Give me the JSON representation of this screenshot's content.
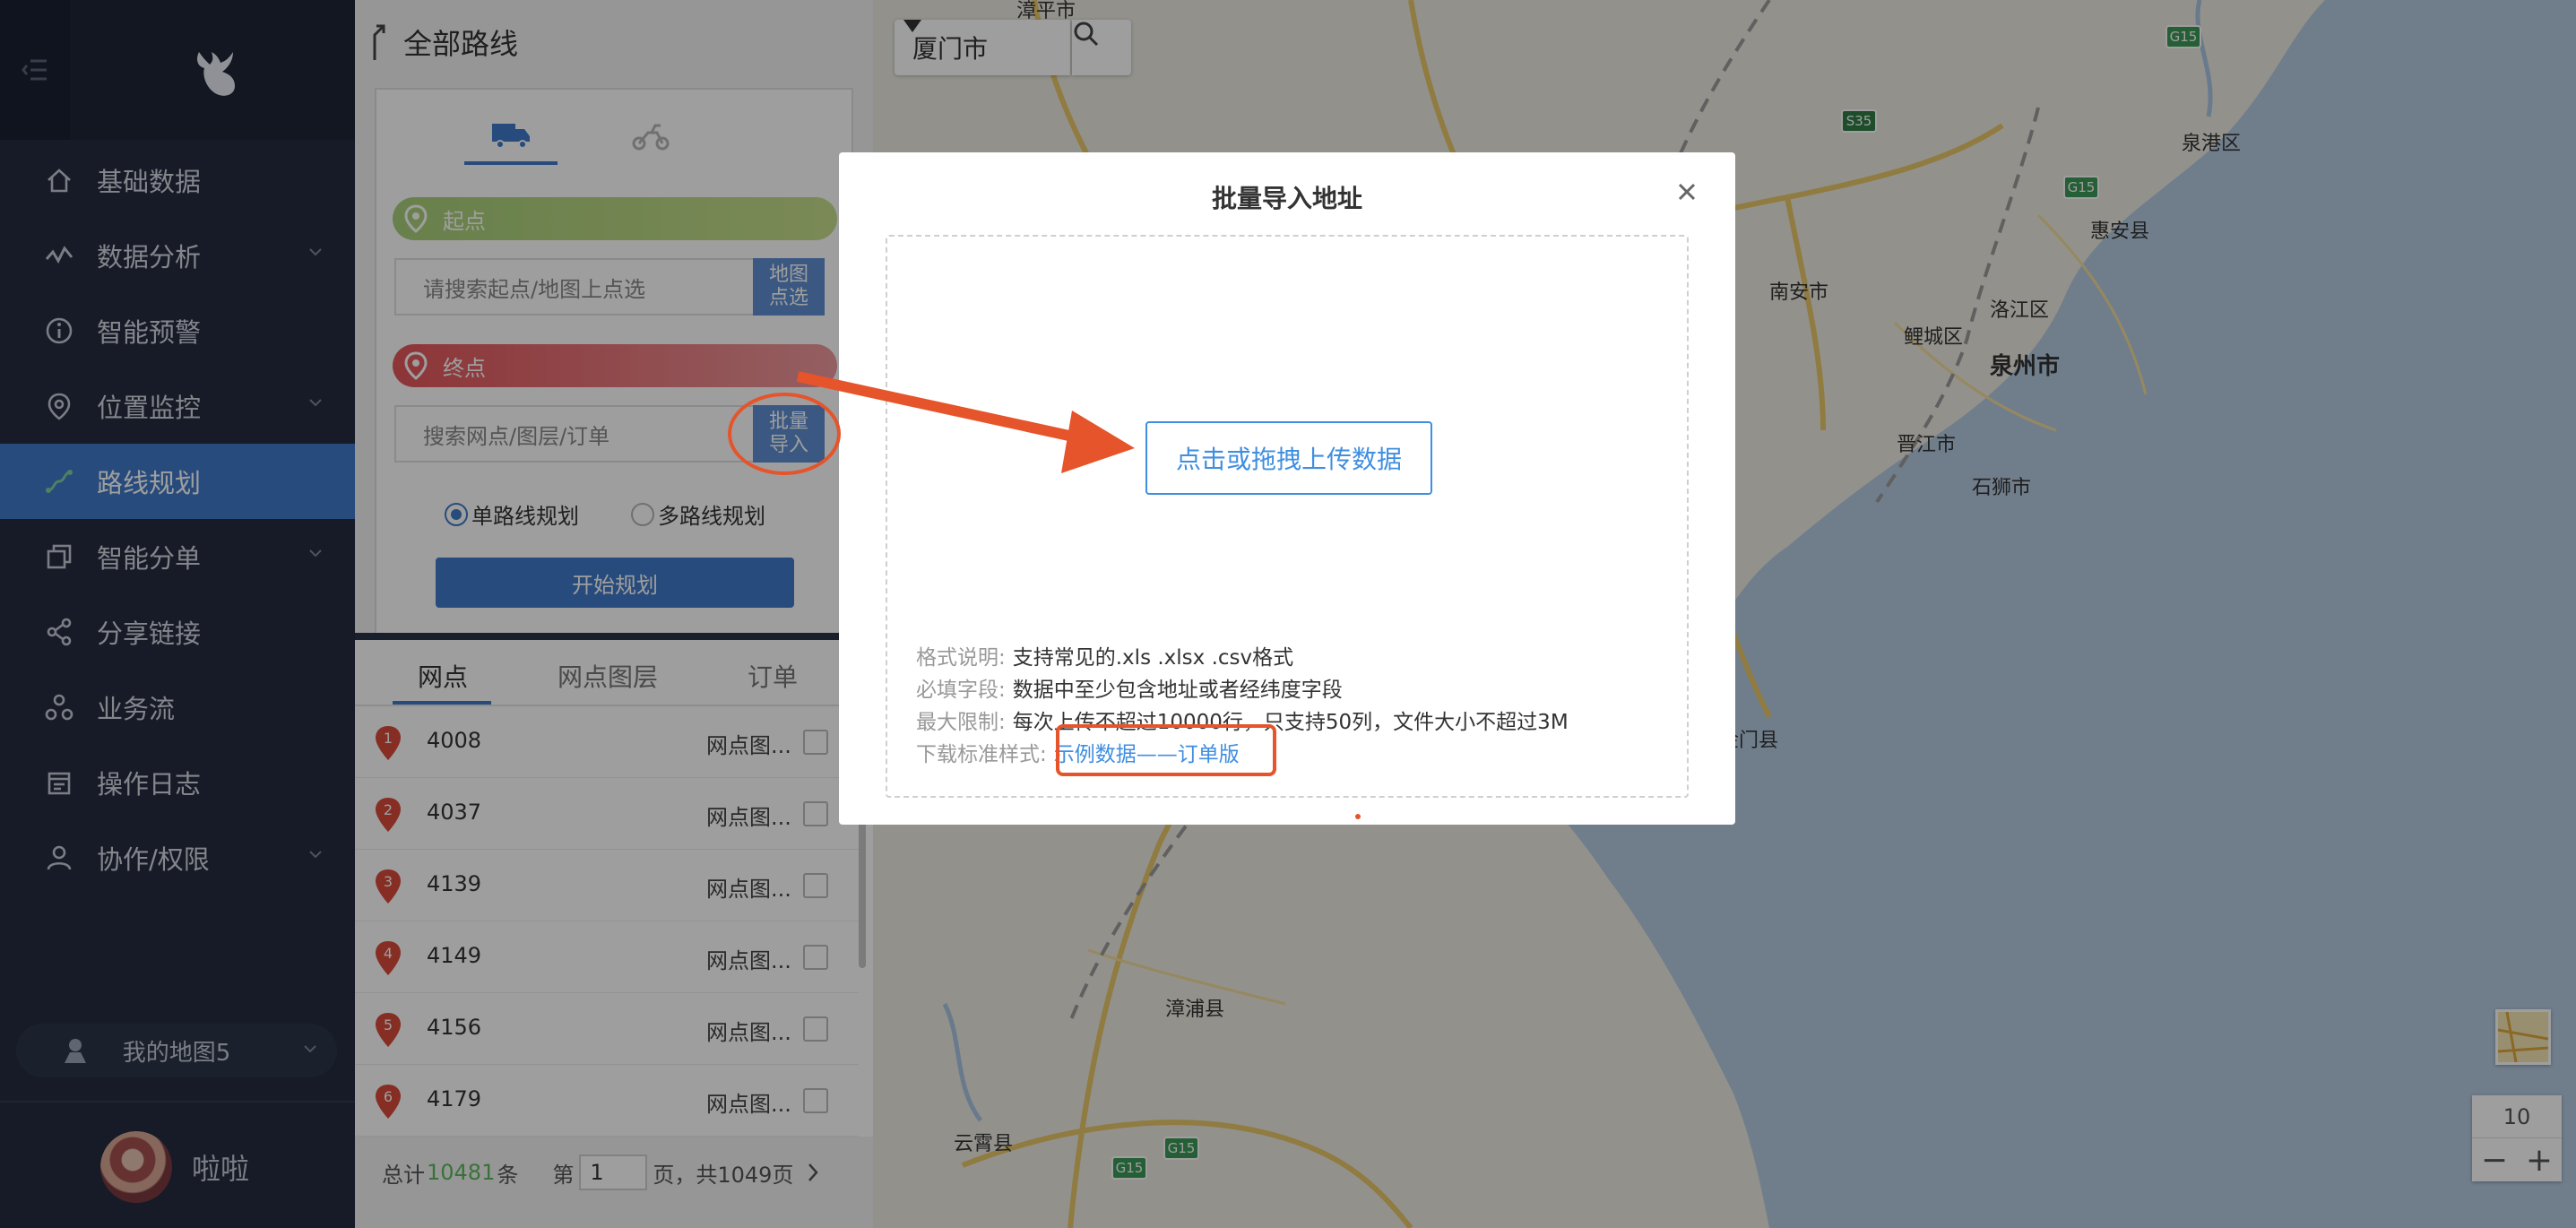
{
  "sidebar": {
    "menu": [
      {
        "label": "基础数据",
        "icon": "home-icon",
        "has_submenu": false,
        "active": false
      },
      {
        "label": "数据分析",
        "icon": "chart-line-icon",
        "has_submenu": true,
        "active": false
      },
      {
        "label": "智能预警",
        "icon": "info-icon",
        "has_submenu": false,
        "active": false
      },
      {
        "label": "位置监控",
        "icon": "location-pin-icon",
        "has_submenu": true,
        "active": false
      },
      {
        "label": "路线规划",
        "icon": "route-icon",
        "has_submenu": false,
        "active": true
      },
      {
        "label": "智能分单",
        "icon": "copy-icon",
        "has_submenu": true,
        "active": false
      },
      {
        "label": "分享链接",
        "icon": "share-icon",
        "has_submenu": false,
        "active": false
      },
      {
        "label": "业务流",
        "icon": "workflow-icon",
        "has_submenu": false,
        "active": false
      },
      {
        "label": "操作日志",
        "icon": "calendar-icon",
        "has_submenu": false,
        "active": false
      },
      {
        "label": "协作/权限",
        "icon": "user-icon",
        "has_submenu": true,
        "active": false
      }
    ],
    "my_map": "我的地图5",
    "user_name": "啦啦"
  },
  "panel": {
    "title": "全部路线",
    "start_label": "起点",
    "start_placeholder": "请搜索起点/地图上点选",
    "start_btn": "地图点选",
    "end_label": "终点",
    "end_placeholder": "搜索网点/图层/订单",
    "end_btn": "批量导入",
    "mode_single": "单路线规划",
    "mode_multi": "多路线规划",
    "plan_btn": "开始规划",
    "list_tabs": [
      "网点",
      "网点图层",
      "订单"
    ],
    "rows": [
      {
        "n": "1",
        "id": "4008",
        "layer": "网点图..."
      },
      {
        "n": "2",
        "id": "4037",
        "layer": "网点图..."
      },
      {
        "n": "3",
        "id": "4139",
        "layer": "网点图..."
      },
      {
        "n": "4",
        "id": "4149",
        "layer": "网点图..."
      },
      {
        "n": "5",
        "id": "4156",
        "layer": "网点图..."
      },
      {
        "n": "6",
        "id": "4179",
        "layer": "网点图..."
      }
    ],
    "pager": {
      "prefix": "总计",
      "total": "10481",
      "unit": "条",
      "page_prefix": "第",
      "page": "1",
      "page_suffix": "页，共1049页"
    }
  },
  "map": {
    "city": "厦门市",
    "zoom_level": "10",
    "labels": [
      {
        "text": "漳平市",
        "big": false
      },
      {
        "text": "泉港区",
        "big": false
      },
      {
        "text": "惠安县",
        "big": false
      },
      {
        "text": "南安市",
        "big": false
      },
      {
        "text": "洛江区",
        "big": false
      },
      {
        "text": "鲤城区",
        "big": false
      },
      {
        "text": "泉州市",
        "big": true
      },
      {
        "text": "晋江市",
        "big": false
      },
      {
        "text": "石狮市",
        "big": false
      },
      {
        "text": "金门县",
        "big": false
      },
      {
        "text": "漳浦县",
        "big": false
      },
      {
        "text": "云霄县",
        "big": false
      }
    ],
    "highways": [
      "G15",
      "S35",
      "G15",
      "G15",
      "G15"
    ]
  },
  "modal": {
    "title": "批量导入地址",
    "upload_label": "点击或拖拽上传数据",
    "info": [
      {
        "k": "格式说明:",
        "v": "支持常见的.xls .xlsx .csv格式"
      },
      {
        "k": "必填字段:",
        "v": "数据中至少包含地址或者经纬度字段"
      },
      {
        "k": "最大限制:",
        "v": "每次上传不超过10000行，只支持50列，文件大小不超过3M"
      }
    ],
    "download_key": "下载标准样式:",
    "download_link": "示例数据——订单版"
  },
  "colors": {
    "sidebar_bg": "#242c3f",
    "accent": "#3f7ac8",
    "link": "#3f8ee0",
    "annotation": "#e5542a"
  }
}
